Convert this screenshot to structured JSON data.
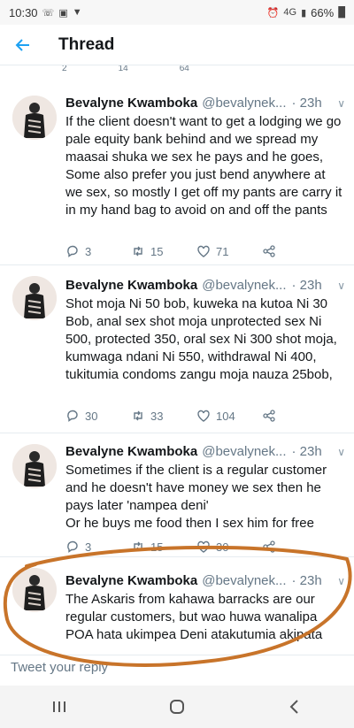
{
  "status_bar": {
    "time": "10:30",
    "battery": "66%",
    "network": "4G"
  },
  "header": {
    "title": "Thread",
    "back_icon": "arrow-left-icon"
  },
  "partial_counts": {
    "replies": "2",
    "retweets": "14",
    "likes": "64"
  },
  "tweets": [
    {
      "name": "Bevalyne Kwamboka",
      "handle": "@bevalynek...",
      "time": "· 23h",
      "text": "If the client doesn't want to get a lodging we go pale equity bank behind and we spread my maasai shuka we sex he pays and he goes, Some also prefer you just bend anywhere at we sex, so mostly I get off my pants are carry it in my hand bag to avoid on and off the pants",
      "replies": "3",
      "retweets": "15",
      "likes": "71"
    },
    {
      "name": "Bevalyne Kwamboka",
      "handle": "@bevalynek...",
      "time": "· 23h",
      "text": "Shot moja Ni 50 bob, kuweka na kutoa Ni 30 Bob, anal sex shot moja unprotected sex Ni 500, protected 350, oral sex Ni 300 shot moja, kumwaga ndani Ni 550, withdrawal Ni 400, tukitumia condoms zangu moja nauza 25bob,",
      "replies": "30",
      "retweets": "33",
      "likes": "104"
    },
    {
      "name": "Bevalyne Kwamboka",
      "handle": "@bevalynek...",
      "time": "· 23h",
      "text": "Sometimes if the client is a regular customer and he doesn't have money we sex then he pays later 'nampea deni'\nOr he buys me food then I sex him for free",
      "replies": "3",
      "retweets": "15",
      "likes": "30"
    },
    {
      "name": "Bevalyne Kwamboka",
      "handle": "@bevalynek...",
      "time": "· 23h",
      "text": "The Askaris from kahawa barracks are our regular customers, but wao huwa wanalipa POA hata ukimpea Deni atakutumia akipata"
    }
  ],
  "reply_bar": {
    "placeholder": "Tweet your reply"
  },
  "nav": {
    "recents_icon": "recents-icon",
    "home_icon": "home-icon",
    "back_icon": "back-chevron-icon"
  },
  "colors": {
    "accent": "#1da1f2",
    "annotation_circle": "#c8742a"
  }
}
